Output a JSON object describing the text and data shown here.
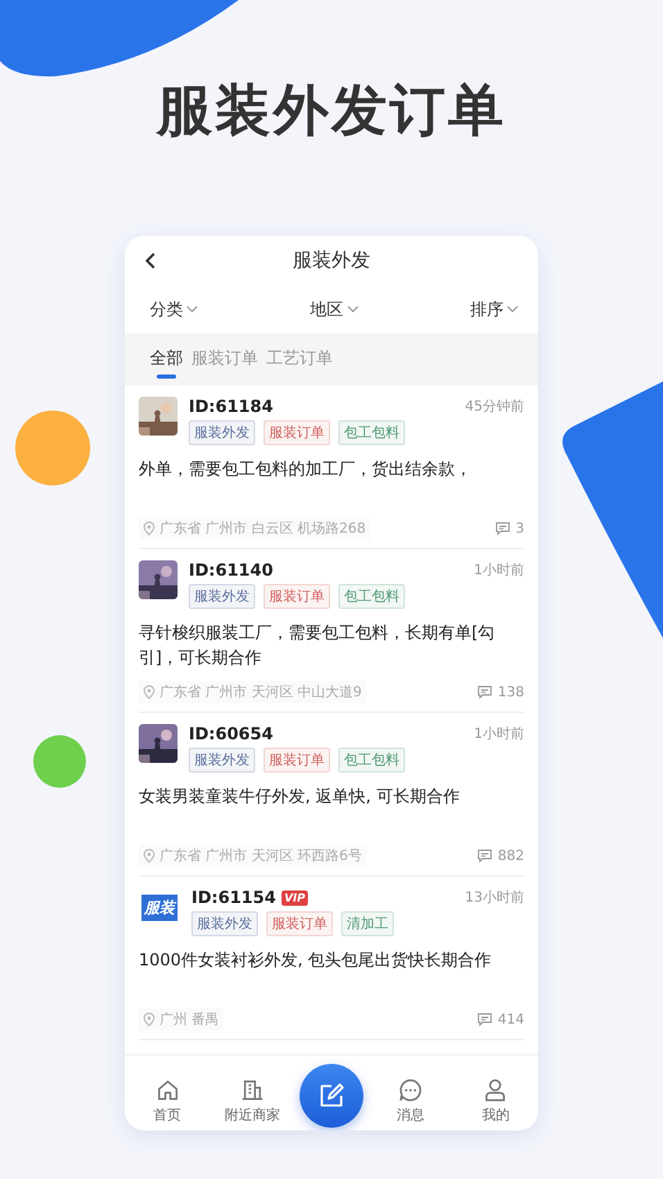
{
  "headline": "服装外发订单",
  "screen": {
    "title": "服装外发",
    "filters": [
      "分类",
      "地区",
      "排序"
    ],
    "tabs": [
      {
        "label": "全部",
        "selected": true
      },
      {
        "label": "服装订单",
        "selected": false
      },
      {
        "label": "工艺订单",
        "selected": false
      }
    ],
    "orders": [
      {
        "avatar": {
          "kind": "picture"
        },
        "id": "ID:61184",
        "time": "45分钟前",
        "tags": [
          {
            "label": "服装外发",
            "color": "#5b6f9c"
          },
          {
            "label": "服装订单",
            "color": "#d0605c"
          },
          {
            "label": "包工包料",
            "color": "#4f9a70"
          }
        ],
        "content": "外单，需要包工包料的加工厂，货出结余款，",
        "location": "广东省 广州市 白云区 机场路268",
        "comments": "3"
      },
      {
        "avatar": {
          "kind": "picture"
        },
        "id": "ID:61140",
        "time": "1小时前",
        "tags": [
          {
            "label": "服装外发",
            "color": "#5b6f9c"
          },
          {
            "label": "服装订单",
            "color": "#d0605c"
          },
          {
            "label": "包工包料",
            "color": "#4f9a70"
          }
        ],
        "content": "寻针梭织服装工厂，需要包工包料，长期有单[勾引]，可长期合作",
        "location": "广东省 广州市 天河区 中山大道9",
        "comments": "138"
      },
      {
        "avatar": {
          "kind": "picture"
        },
        "id": "ID:60654",
        "time": "1小时前",
        "tags": [
          {
            "label": "服装外发",
            "color": "#5b6f9c"
          },
          {
            "label": "服装订单",
            "color": "#d0605c"
          },
          {
            "label": "包工包料",
            "color": "#4f9a70"
          }
        ],
        "content": "女装男装童装牛仔外发, 返单快, 可长期合作",
        "location": "广东省 广州市 天河区 环西路6号",
        "comments": "882"
      },
      {
        "avatar": {
          "kind": "logo",
          "text": "服装"
        },
        "id": "ID:61154",
        "badge": "VIP",
        "time": "13小时前",
        "tags": [
          {
            "label": "服装外发",
            "color": "#5b6f9c"
          },
          {
            "label": "服装订单",
            "color": "#d0605c"
          },
          {
            "label": "清加工",
            "color": "#4f9a70"
          }
        ],
        "content": "1000件女装衬衫外发, 包头包尾出货快长期合作",
        "location": "广州 番禺",
        "comments": "414"
      }
    ],
    "nav": [
      {
        "label": "首页",
        "kind": "home"
      },
      {
        "label": "附近商家",
        "kind": "building"
      },
      {
        "kind": "publish"
      },
      {
        "label": "消息",
        "kind": "chat"
      },
      {
        "label": "我的",
        "kind": "person"
      }
    ]
  }
}
